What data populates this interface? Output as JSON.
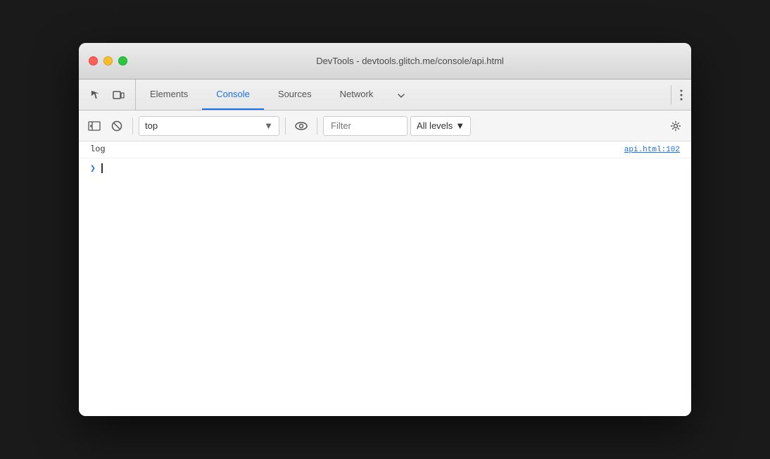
{
  "window": {
    "title": "DevTools - devtools.glitch.me/console/api.html"
  },
  "traffic_lights": {
    "close_label": "close",
    "minimize_label": "minimize",
    "maximize_label": "maximize"
  },
  "tabs": [
    {
      "id": "elements",
      "label": "Elements",
      "active": false
    },
    {
      "id": "console",
      "label": "Console",
      "active": true
    },
    {
      "id": "sources",
      "label": "Sources",
      "active": false
    },
    {
      "id": "network",
      "label": "Network",
      "active": false
    }
  ],
  "toolbar": {
    "context_value": "top",
    "context_placeholder": "top",
    "filter_placeholder": "Filter",
    "filter_value": "",
    "levels_label": "All levels",
    "levels_chevron": "▼"
  },
  "console": {
    "log_message": "log",
    "log_source": "api.html:102",
    "prompt": ">"
  }
}
